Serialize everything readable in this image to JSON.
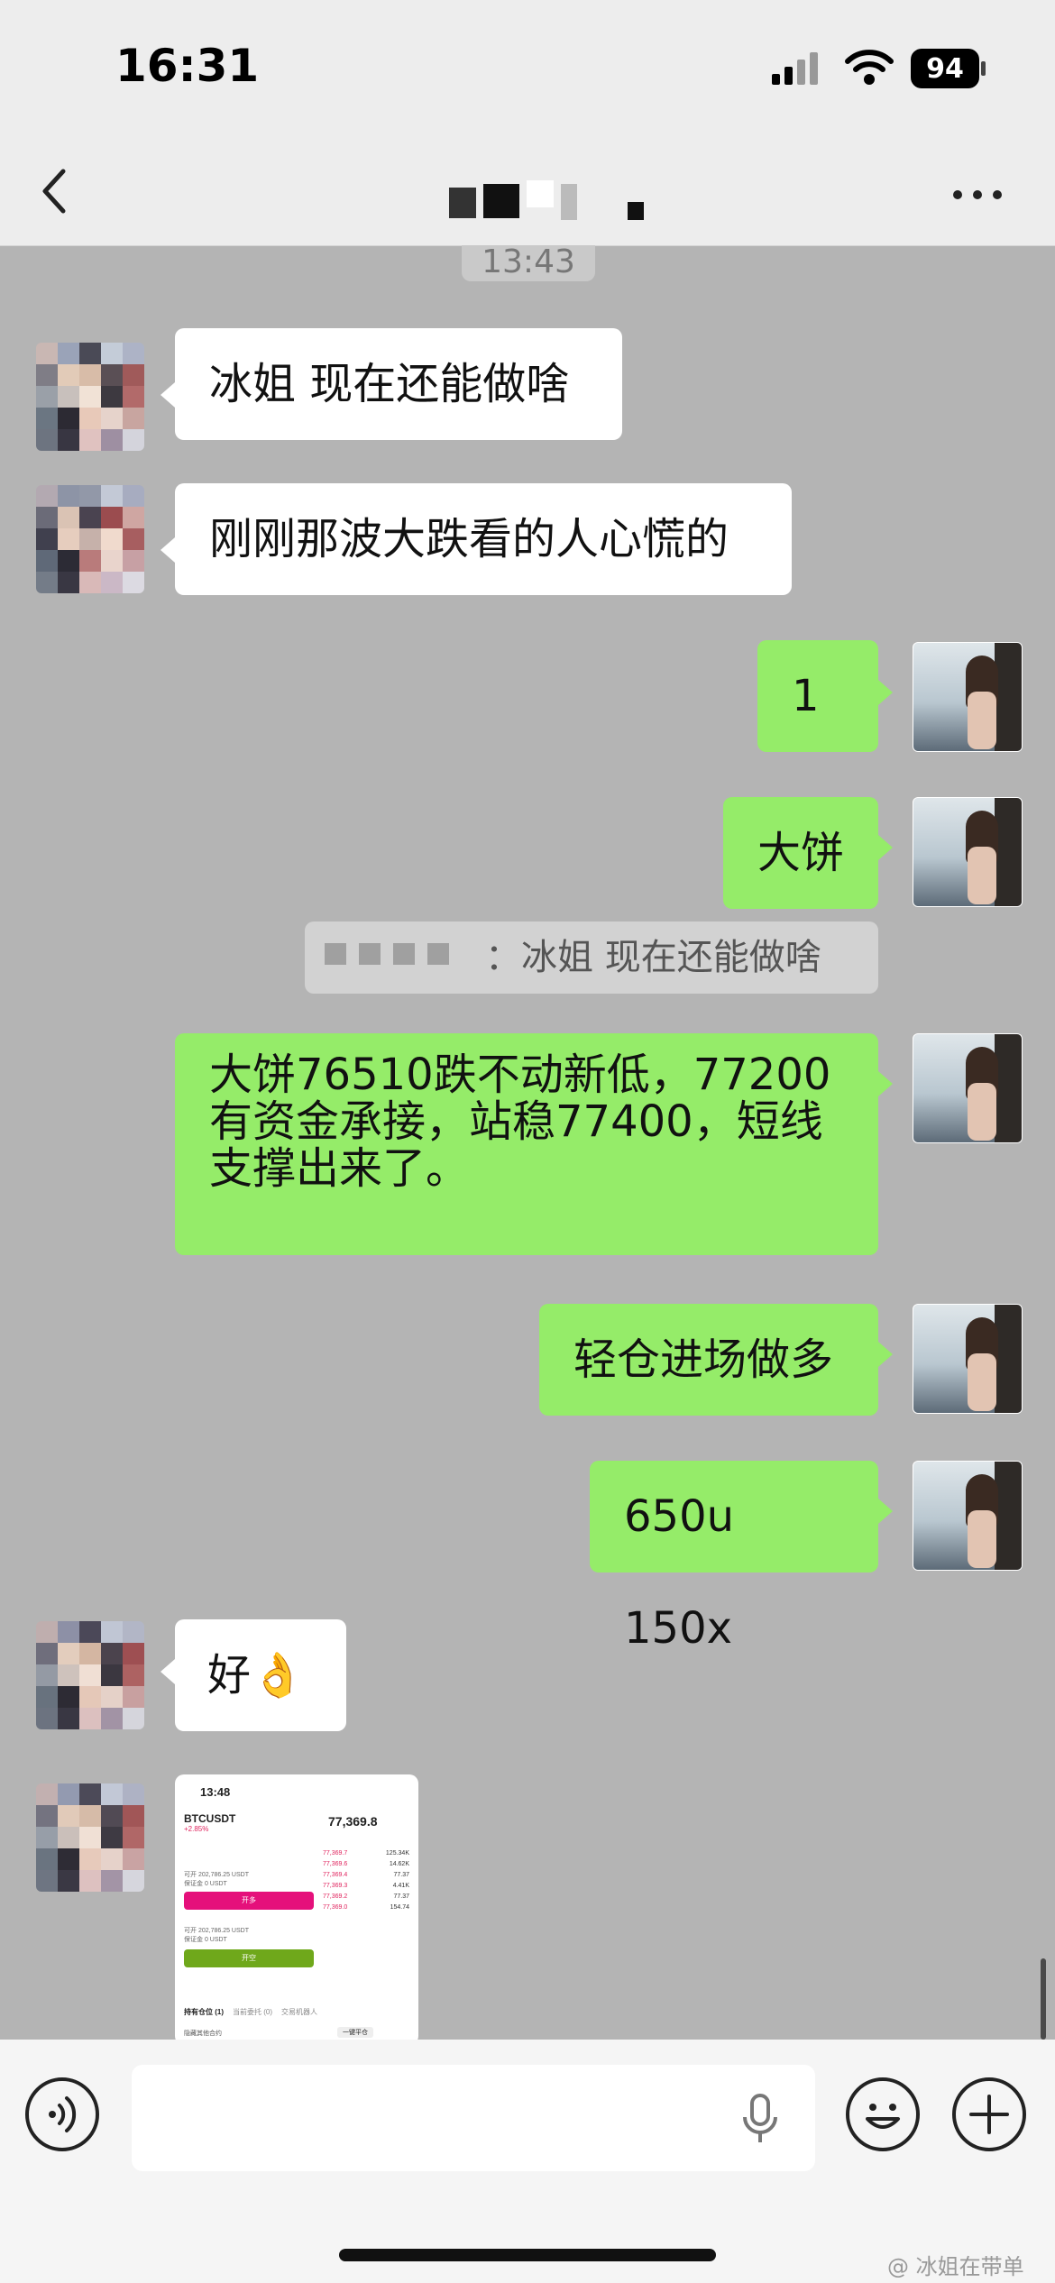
{
  "status_bar": {
    "time": "16:31",
    "battery": "94"
  },
  "nav": {
    "title": ""
  },
  "chat": {
    "timestamp": "13:43",
    "messages": [
      {
        "side": "left",
        "text": "冰姐 现在还能做啥"
      },
      {
        "side": "left",
        "text": "刚刚那波大跌看的人心慌的"
      },
      {
        "side": "right",
        "text": "1"
      },
      {
        "side": "right",
        "text": "大饼"
      },
      {
        "side": "quote",
        "text": "：冰姐 现在还能做啥"
      },
      {
        "side": "right",
        "text": "大饼76510跌不动新低，77200有资金承接，站稳77400，短线支撑出来了。"
      },
      {
        "side": "right",
        "text": "轻仓进场做多"
      },
      {
        "side": "right",
        "text": "650u 150x"
      },
      {
        "side": "left",
        "text": "好👌"
      }
    ],
    "image_message": {
      "time": "13:48",
      "pair": "BTCUSDT",
      "change": "+2.85%",
      "price": "77,369.8",
      "rows": [
        "可开 202,786.25 USDT",
        "保证金 0 USDT"
      ],
      "order_book": [
        [
          "77,369.7",
          "125.34K"
        ],
        [
          "77,369.6",
          "14.62K"
        ],
        [
          "77,369.4",
          "77.37"
        ],
        [
          "77,369.3",
          "4.41K"
        ],
        [
          "77,369.2",
          "77.37"
        ],
        [
          "77,369.0",
          "154.74"
        ]
      ],
      "btn_long": "开多",
      "btn_short": "开空",
      "tabs": [
        "持有仓位 (1)",
        "当前委托 (0)",
        "交易机器人"
      ],
      "hide_label": "隐藏其他合约",
      "close_all": "一键平仓"
    }
  },
  "watermark": "@ 冰姐在带单",
  "colors": {
    "sent_bubble": "#95ec69",
    "received_bubble": "#ffffff",
    "chat_bg": "#b4b4b4"
  }
}
